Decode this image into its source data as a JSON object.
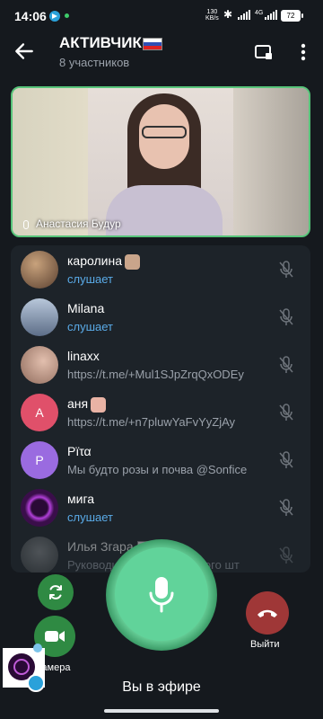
{
  "status_bar": {
    "time": "14:06",
    "net_speed_value": "130",
    "net_speed_unit": "KB/s",
    "network": "4G",
    "battery": "72"
  },
  "header": {
    "title": "АКТИВЧИК",
    "subtitle": "8 участников"
  },
  "video": {
    "speaker_name": "Анастасия Будур"
  },
  "participants": [
    {
      "name": "каролина",
      "status": "слушает",
      "listening": true,
      "avatar_color": "#8a6a4f",
      "has_emoji": true
    },
    {
      "name": "Milana",
      "status": "слушает",
      "listening": true,
      "avatar_color": "#7e8a9c"
    },
    {
      "name": "linaxx",
      "status": "https://t.me/+Mul1SJpZrqQxODEy",
      "listening": false,
      "avatar_color": "#b98f80"
    },
    {
      "name": "аня",
      "status": "https://t.me/+n7pluwYaFvYyZjAy",
      "listening": false,
      "avatar_color": "#e0506a",
      "initial": "А",
      "has_emoji": true
    },
    {
      "name": "Pïτα",
      "status": "Мы будто розы и почва @Sonfice",
      "listening": false,
      "avatar_color": "#9a6be0",
      "initial": "P"
    },
    {
      "name": "мига",
      "status": "слушает",
      "listening": true,
      "avatar_color": "#3a0e4a"
    },
    {
      "name": "Илья Згара",
      "status": "Руководитель Солидарского шт",
      "listening": false,
      "avatar_color": "#4a4f55",
      "has_flag": true
    }
  ],
  "controls": {
    "camera_label": "Камера",
    "leave_label": "Выйти",
    "status_label": "Вы в эфире"
  },
  "colors": {
    "accent_green": "#61d39a",
    "leave_red": "#9f3737",
    "listening_blue": "#5aabe8",
    "video_border": "#57c47a"
  }
}
